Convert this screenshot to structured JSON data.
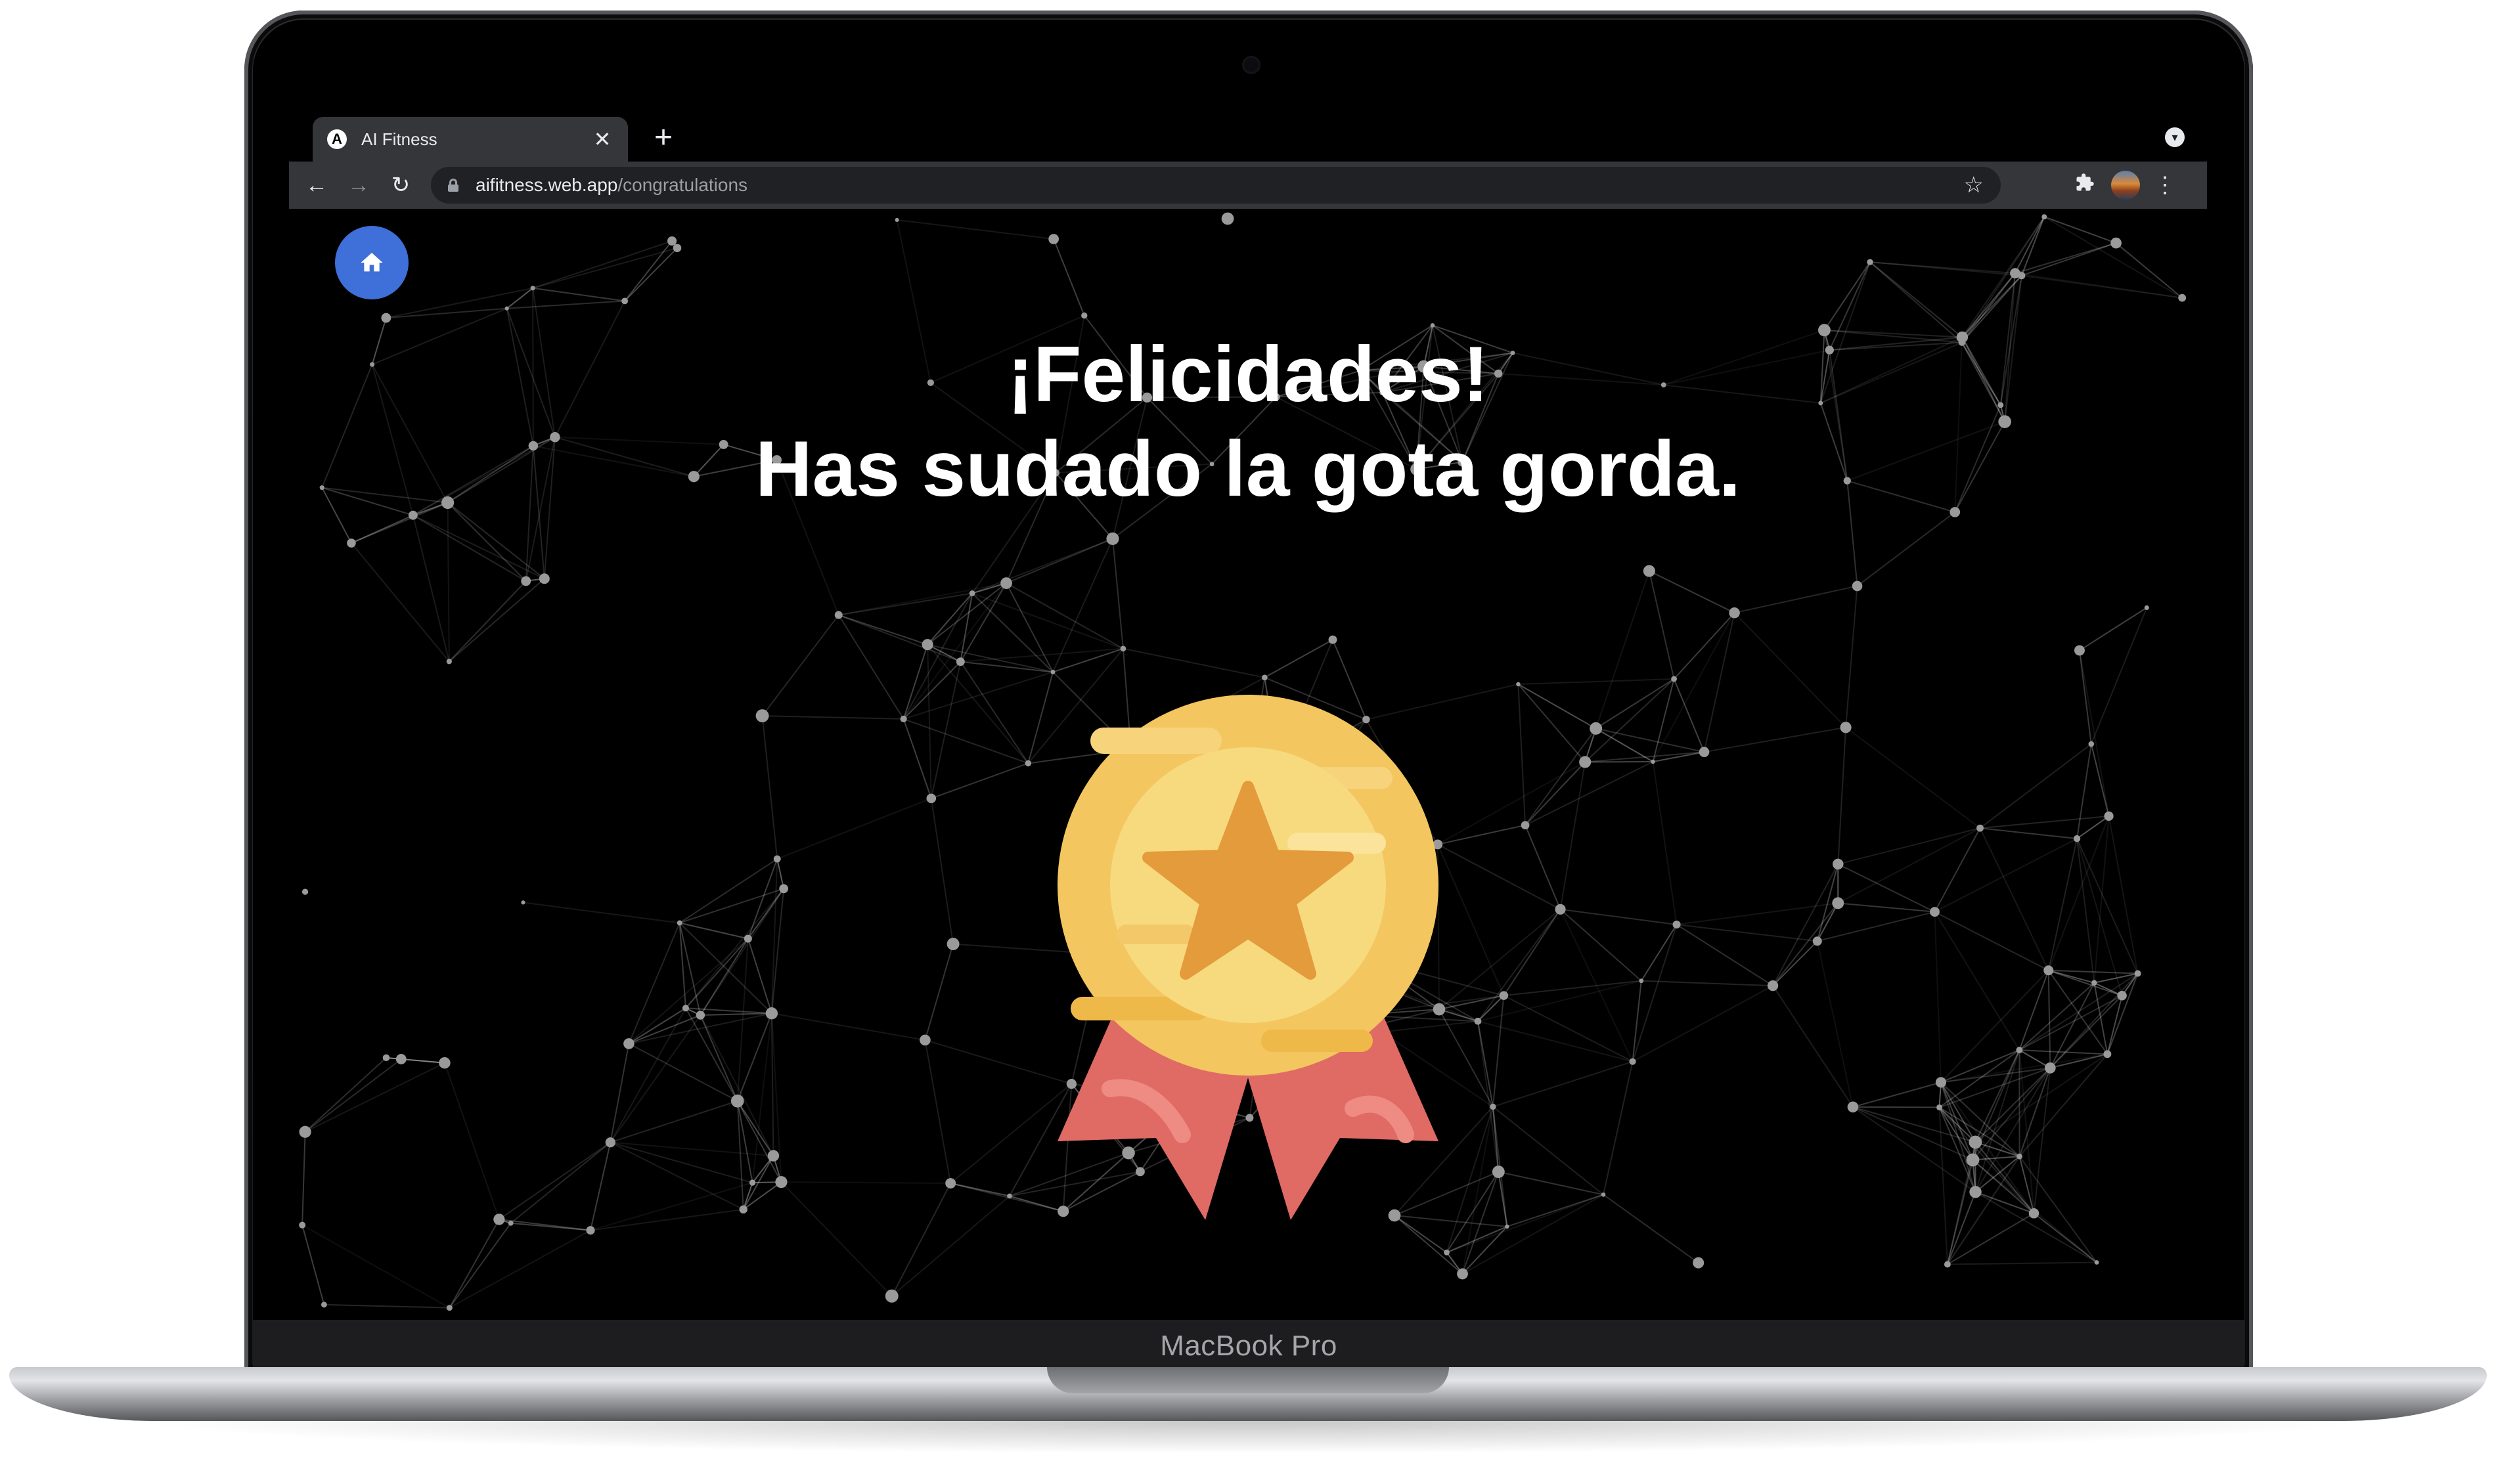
{
  "device": {
    "label": "MacBook Pro"
  },
  "browser": {
    "tab": {
      "title": "AI Fitness",
      "favicon_letter": "A",
      "close_glyph": "✕"
    },
    "new_tab_glyph": "+",
    "url": {
      "host": "aifitness.web.app",
      "path": "/congratulations"
    },
    "icons": {
      "back": "back-arrow-icon",
      "forward": "forward-arrow-icon",
      "reload": "reload-icon",
      "bookmark": "star-icon",
      "extensions": "puzzle-icon",
      "menu": "kebab-menu-icon",
      "tab_search": "chevron-down-icon"
    }
  },
  "page": {
    "home_button": {
      "icon": "home-icon",
      "color": "#3f6fd8"
    },
    "headline": {
      "line1": "¡Felicidades!",
      "line2": "Has sudado la gota gorda."
    },
    "medal": {
      "icon": "medal-star-icon",
      "gold": "#f5c76a",
      "ribbon": "#e06a64"
    },
    "background": {
      "color": "#000000",
      "style": "particle-network"
    }
  }
}
